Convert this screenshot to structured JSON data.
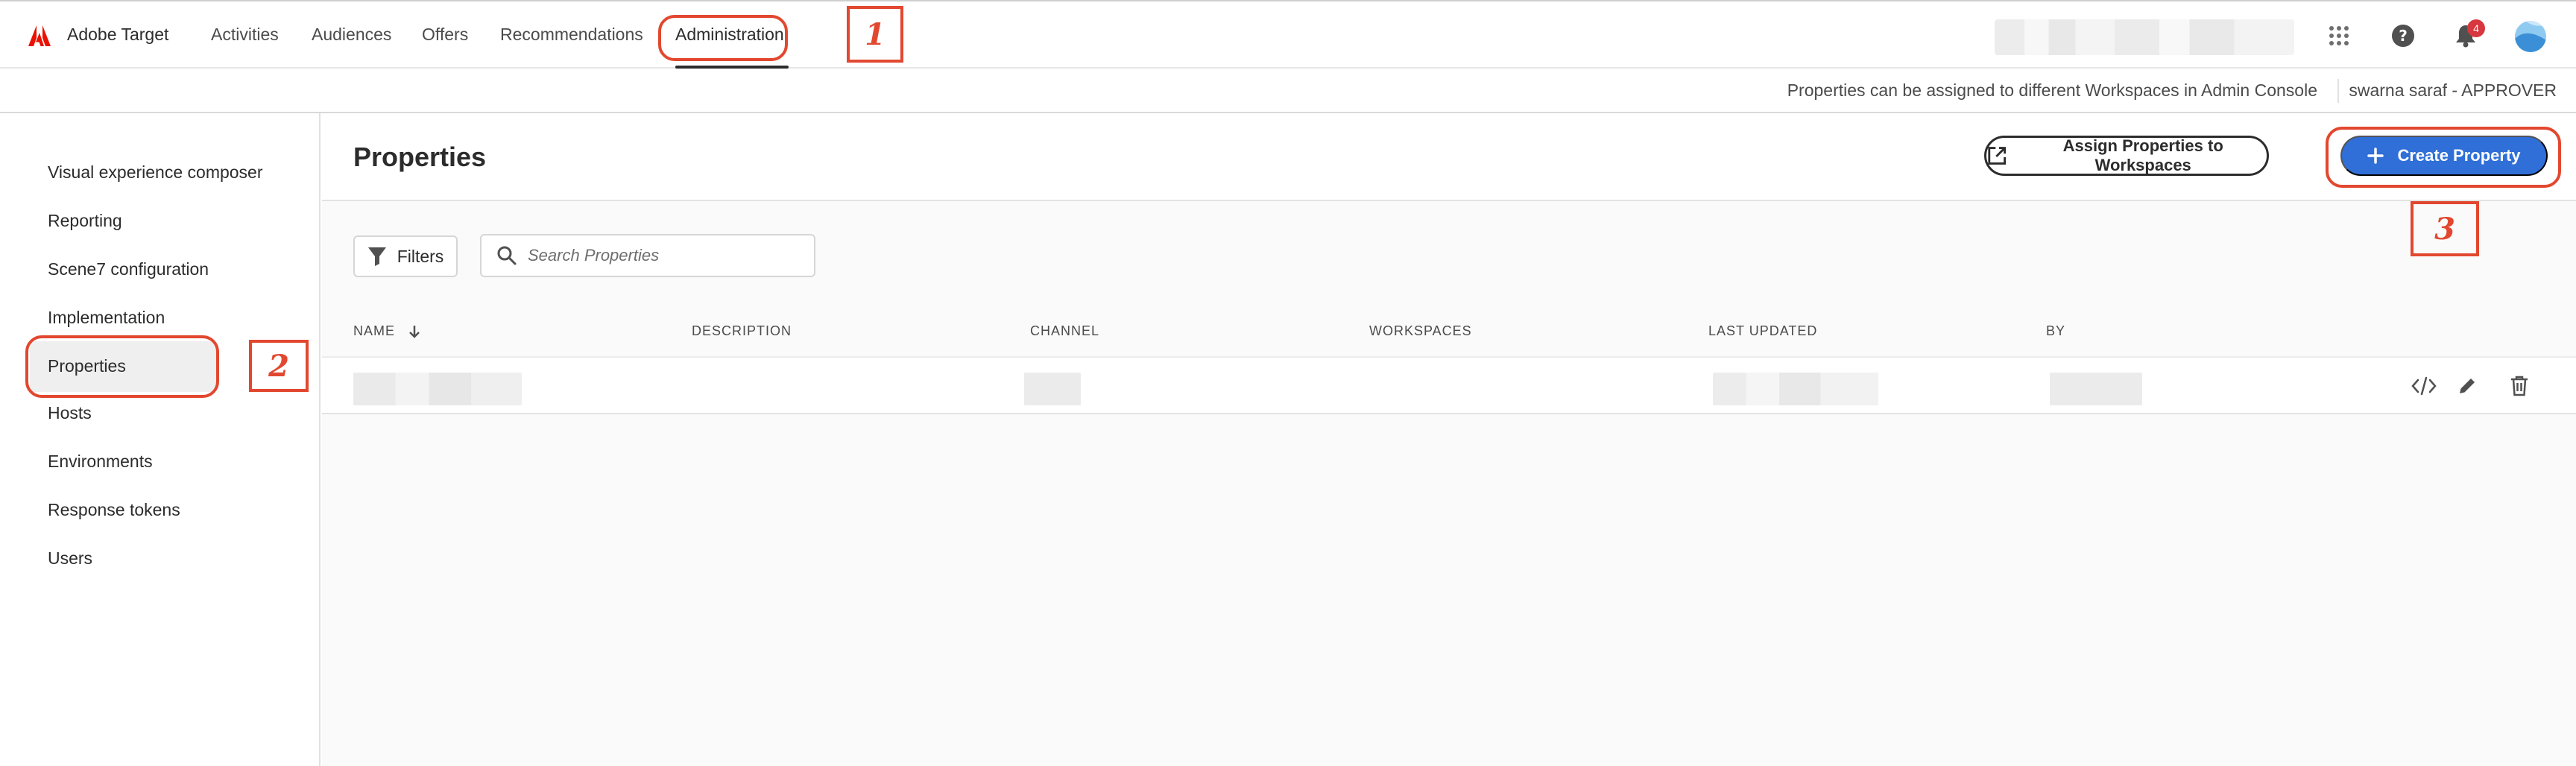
{
  "app": {
    "brand": "Adobe Target",
    "brand_color": "#eb1000"
  },
  "nav": {
    "items": [
      {
        "label": "Activities"
      },
      {
        "label": "Audiences"
      },
      {
        "label": "Offers"
      },
      {
        "label": "Recommendations"
      },
      {
        "label": "Administration",
        "active": true
      }
    ]
  },
  "topbar_icons": {
    "apps": "apps-grid-icon",
    "help": "help-icon",
    "notifications": "bell-icon",
    "notification_count": "4"
  },
  "infobar": {
    "message": "Properties can be assigned to different Workspaces in Admin Console",
    "user": "swarna saraf - APPROVER"
  },
  "sidebar": {
    "items": [
      {
        "label": "Visual experience composer"
      },
      {
        "label": "Reporting"
      },
      {
        "label": "Scene7 configuration"
      },
      {
        "label": "Implementation"
      },
      {
        "label": "Properties",
        "active": true
      },
      {
        "label": "Hosts"
      },
      {
        "label": "Environments"
      },
      {
        "label": "Response tokens"
      },
      {
        "label": "Users"
      }
    ]
  },
  "main": {
    "title": "Properties",
    "assign_label": "Assign Properties to Workspaces",
    "create_label": "Create Property",
    "filters_label": "Filters",
    "search_placeholder": "Search Properties",
    "columns": [
      "NAME",
      "DESCRIPTION",
      "CHANNEL",
      "WORKSPACES",
      "LAST UPDATED",
      "BY"
    ]
  },
  "annotations": [
    "1",
    "2",
    "3"
  ],
  "colors": {
    "accent_blue": "#2f6fd7",
    "annotation_red": "#e2482f",
    "badge_red": "#d7373f"
  }
}
